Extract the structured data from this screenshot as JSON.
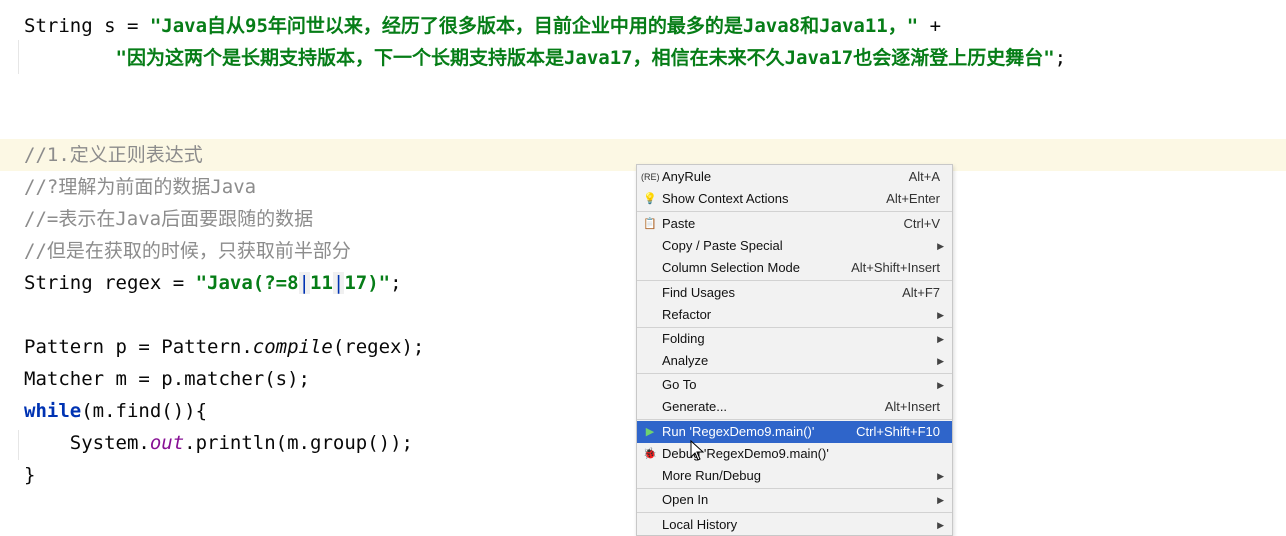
{
  "code": {
    "line1": {
      "prefix": "String s = ",
      "string": "\"Java自从95年问世以来，经历了很多版本，目前企业中用的最多的是Java8和Java11，\"",
      "suffix": " +"
    },
    "line2": {
      "indent": "        ",
      "string": "\"因为这两个是长期支持版本，下一个长期支持版本是Java17，相信在未来不久Java17也会逐渐登上历史舞台\"",
      "suffix": ";"
    },
    "comment1": "//1.定义正则表达式",
    "comment2": "//?理解为前面的数据Java",
    "comment3": "//=表示在Java后面要跟随的数据",
    "comment4": "//但是在获取的时候，只获取前半部分",
    "regex_line": {
      "prefix": "String regex = ",
      "q1": "\"Java(?=8",
      "p1": "|",
      "mid": "11",
      "p2": "|",
      "end": "17)\"",
      "suffix": ";"
    },
    "pattern_line": {
      "prefix": "Pattern p = Pattern.",
      "method": "compile",
      "suffix": "(regex);"
    },
    "matcher_line": "Matcher m = p.matcher(s);",
    "while_line": {
      "kw": "while",
      "rest": "(m.find()){"
    },
    "println_line": {
      "indent": "    System.",
      "field": "out",
      "rest": ".println(m.group());"
    },
    "close_brace": "}"
  },
  "context_menu": {
    "items": [
      {
        "icon": "(RE)",
        "label": "AnyRule",
        "shortcut": "Alt+A"
      },
      {
        "icon": "💡",
        "label": "Show Context Actions",
        "shortcut": "Alt+Enter"
      },
      {
        "icon": "📋",
        "label": "Paste",
        "shortcut": "Ctrl+V"
      },
      {
        "label": "Copy / Paste Special",
        "submenu": "▶"
      },
      {
        "label": "Column Selection Mode",
        "shortcut": "Alt+Shift+Insert"
      },
      {
        "label": "Find Usages",
        "shortcut": "Alt+F7"
      },
      {
        "label": "Refactor",
        "submenu": "▶"
      },
      {
        "label": "Folding",
        "submenu": "▶"
      },
      {
        "label": "Analyze",
        "submenu": "▶"
      },
      {
        "label": "Go To",
        "submenu": "▶"
      },
      {
        "label": "Generate...",
        "shortcut": "Alt+Insert"
      },
      {
        "icon": "▶",
        "label": "Run 'RegexDemo9.main()'",
        "shortcut": "Ctrl+Shift+F10"
      },
      {
        "icon": "🐞",
        "label": "Debug 'RegexDemo9.main()'"
      },
      {
        "label": "More Run/Debug",
        "submenu": "▶"
      },
      {
        "label": "Open In",
        "submenu": "▶"
      },
      {
        "label": "Local History",
        "submenu": "▶"
      }
    ]
  },
  "colors": {
    "selection": "#2f65ca",
    "string": "#067d17",
    "keyword": "#0033b3",
    "comment": "#8c8c8c"
  }
}
